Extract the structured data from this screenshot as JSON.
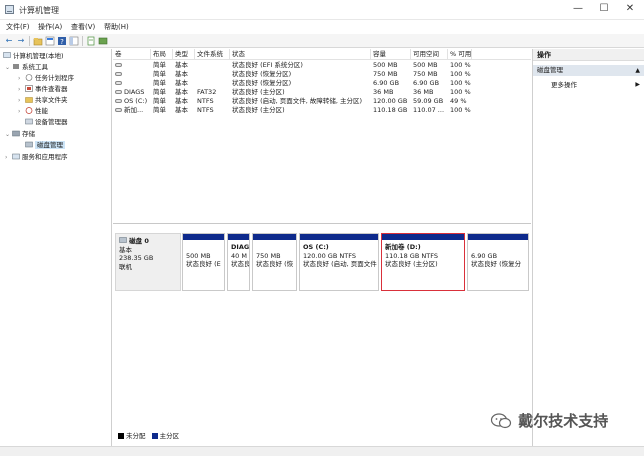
{
  "window": {
    "title": "计算机管理",
    "controls": {
      "minimize": "—",
      "maximize": "☐",
      "close": "✕"
    }
  },
  "menu": [
    "文件(F)",
    "操作(A)",
    "查看(V)",
    "帮助(H)"
  ],
  "toolbar": {
    "icons": [
      "back-arrow-icon",
      "forward-arrow-icon",
      "folder-up-icon",
      "properties-icon",
      "help-icon",
      "show-hide-tree-icon",
      "help-topics-icon",
      "extra-icon"
    ]
  },
  "tree": {
    "root": "计算机管理(本地)",
    "items": [
      {
        "label": "系统工具",
        "level": 1,
        "expanded": true,
        "icon": "tools-icon"
      },
      {
        "label": "任务计划程序",
        "level": 2,
        "expanded": false,
        "icon": "clock-icon"
      },
      {
        "label": "事件查看器",
        "level": 2,
        "expanded": false,
        "icon": "event-viewer-icon"
      },
      {
        "label": "共享文件夹",
        "level": 2,
        "expanded": false,
        "icon": "shared-folder-icon"
      },
      {
        "label": "性能",
        "level": 2,
        "expanded": false,
        "icon": "performance-icon"
      },
      {
        "label": "设备管理器",
        "level": 2,
        "expanded": null,
        "icon": "device-manager-icon"
      },
      {
        "label": "存储",
        "level": 1,
        "expanded": true,
        "icon": "storage-icon"
      },
      {
        "label": "磁盘管理",
        "level": 2,
        "expanded": null,
        "icon": "disk-management-icon",
        "selected": true
      },
      {
        "label": "服务和应用程序",
        "level": 1,
        "expanded": false,
        "icon": "services-icon"
      }
    ]
  },
  "volumes": {
    "headers": [
      "卷",
      "布局",
      "类型",
      "文件系统",
      "状态",
      "容量",
      "可用空间",
      "% 可用"
    ],
    "rows": [
      [
        "",
        "简单",
        "基本",
        "",
        "状态良好 (EFI 系统分区)",
        "500 MB",
        "500 MB",
        "100 %"
      ],
      [
        "",
        "简单",
        "基本",
        "",
        "状态良好 (恢复分区)",
        "750 MB",
        "750 MB",
        "100 %"
      ],
      [
        "",
        "简单",
        "基本",
        "",
        "状态良好 (恢复分区)",
        "6.90 GB",
        "6.90 GB",
        "100 %"
      ],
      [
        "DIAGS",
        "简单",
        "基本",
        "FAT32",
        "状态良好 (主分区)",
        "36 MB",
        "36 MB",
        "100 %"
      ],
      [
        "OS (C:)",
        "简单",
        "基本",
        "NTFS",
        "状态良好 (启动, 页面文件, 故障转储, 主分区)",
        "120.00 GB",
        "59.09 GB",
        "49 %"
      ],
      [
        "新加...",
        "简单",
        "基本",
        "NTFS",
        "状态良好 (主分区)",
        "110.18 GB",
        "110.07 ...",
        "100 %"
      ]
    ]
  },
  "disk": {
    "name": "磁盘 0",
    "type": "基本",
    "size": "238.35 GB",
    "status": "联机",
    "partitions": [
      {
        "name": "",
        "size": "500 MB",
        "status": "状态良好 (E"
      },
      {
        "name": "DIAG",
        "size": "40 M",
        "status": "状态良"
      },
      {
        "name": "",
        "size": "750 MB",
        "status": "状态良好 (恢"
      },
      {
        "name": "OS  (C:)",
        "size": "120.00 GB NTFS",
        "status": "状态良好 (启动, 页面文件"
      },
      {
        "name": "新加卷  (D:)",
        "size": "110.18 GB NTFS",
        "status": "状态良好 (主分区)"
      },
      {
        "name": "",
        "size": "6.90 GB",
        "status": "状态良好 (恢复分"
      }
    ]
  },
  "legend": [
    {
      "label": "未分配",
      "color": "#000000"
    },
    {
      "label": "主分区",
      "color": "#0e2a8c"
    }
  ],
  "actions": {
    "header": "操作",
    "section": "磁盘管理",
    "more": "更多操作"
  },
  "watermark": {
    "text": "戴尔技术支持"
  },
  "colors": {
    "partition_bar": "#0e2a8c",
    "selected_border": "#d9303a",
    "tree_selected": "#cce4f7"
  }
}
